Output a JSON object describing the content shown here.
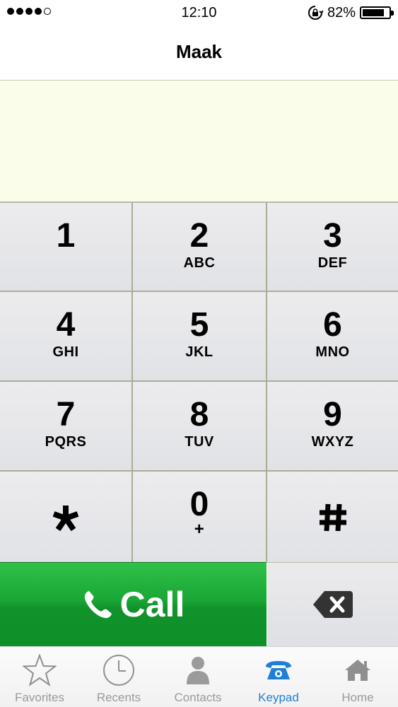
{
  "status_bar": {
    "signal_dots": 5,
    "signal_filled": 4,
    "time": "12:10",
    "battery_percent": "82%",
    "battery_level": 0.82
  },
  "header": {
    "title": "Maak"
  },
  "display": {
    "number": ""
  },
  "keypad": {
    "keys": [
      {
        "digit": "1",
        "letters": ""
      },
      {
        "digit": "2",
        "letters": "ABC"
      },
      {
        "digit": "3",
        "letters": "DEF"
      },
      {
        "digit": "4",
        "letters": "GHI"
      },
      {
        "digit": "5",
        "letters": "JKL"
      },
      {
        "digit": "6",
        "letters": "MNO"
      },
      {
        "digit": "7",
        "letters": "PQRS"
      },
      {
        "digit": "8",
        "letters": "TUV"
      },
      {
        "digit": "9",
        "letters": "WXYZ"
      },
      {
        "digit": "",
        "letters": "",
        "icon": "asterisk-icon"
      },
      {
        "digit": "0",
        "letters": "+"
      },
      {
        "digit": "",
        "letters": "",
        "icon": "hash-icon"
      }
    ]
  },
  "call": {
    "label": "Call",
    "icon": "phone-icon",
    "color": "#1aa635"
  },
  "backspace": {
    "icon": "backspace-icon"
  },
  "tabs": [
    {
      "label": "Favorites",
      "icon": "star-icon",
      "active": false
    },
    {
      "label": "Recents",
      "icon": "clock-icon",
      "active": false
    },
    {
      "label": "Contacts",
      "icon": "person-icon",
      "active": false
    },
    {
      "label": "Keypad",
      "icon": "keypad-phone-icon",
      "active": true
    },
    {
      "label": "Home",
      "icon": "home-icon",
      "active": false
    }
  ],
  "colors": {
    "active_tab": "#1f7fd6",
    "inactive_tab": "#9a9a9a",
    "display_bg": "#fafdea",
    "grid_line": "#a9ad98"
  }
}
